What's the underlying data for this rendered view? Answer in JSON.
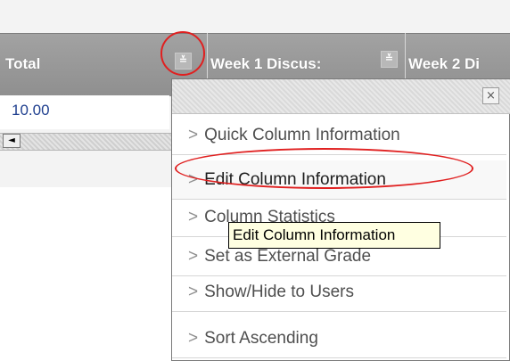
{
  "grid": {
    "columns": [
      {
        "label": "Total"
      },
      {
        "label": "Week 1 Discus:"
      },
      {
        "label": "Week 2 Di"
      }
    ],
    "rows": [
      {
        "total": "10.00"
      }
    ],
    "icons": {
      "column_menu": "chevron-down-icon",
      "scroll_left": "scroll-left-icon"
    },
    "scroll_left_glyph": "◄",
    "chevron_glyph": "≚"
  },
  "menu": {
    "close_glyph": "×",
    "arrow_glyph": ">",
    "items": [
      {
        "label": "Quick Column Information"
      },
      {
        "label": "Edit Column Information",
        "active": true
      },
      {
        "label": "Column Statistics"
      },
      {
        "label": "Set as External Grade"
      },
      {
        "label": "Show/Hide to Users"
      },
      {
        "label": "Sort Ascending"
      }
    ]
  },
  "tooltip": {
    "text": "Edit Column Information"
  },
  "colors": {
    "highlight_ring": "#e02020",
    "header_bg": "#999999",
    "tooltip_bg": "#ffffe1",
    "value_text": "#1f3f8f"
  }
}
